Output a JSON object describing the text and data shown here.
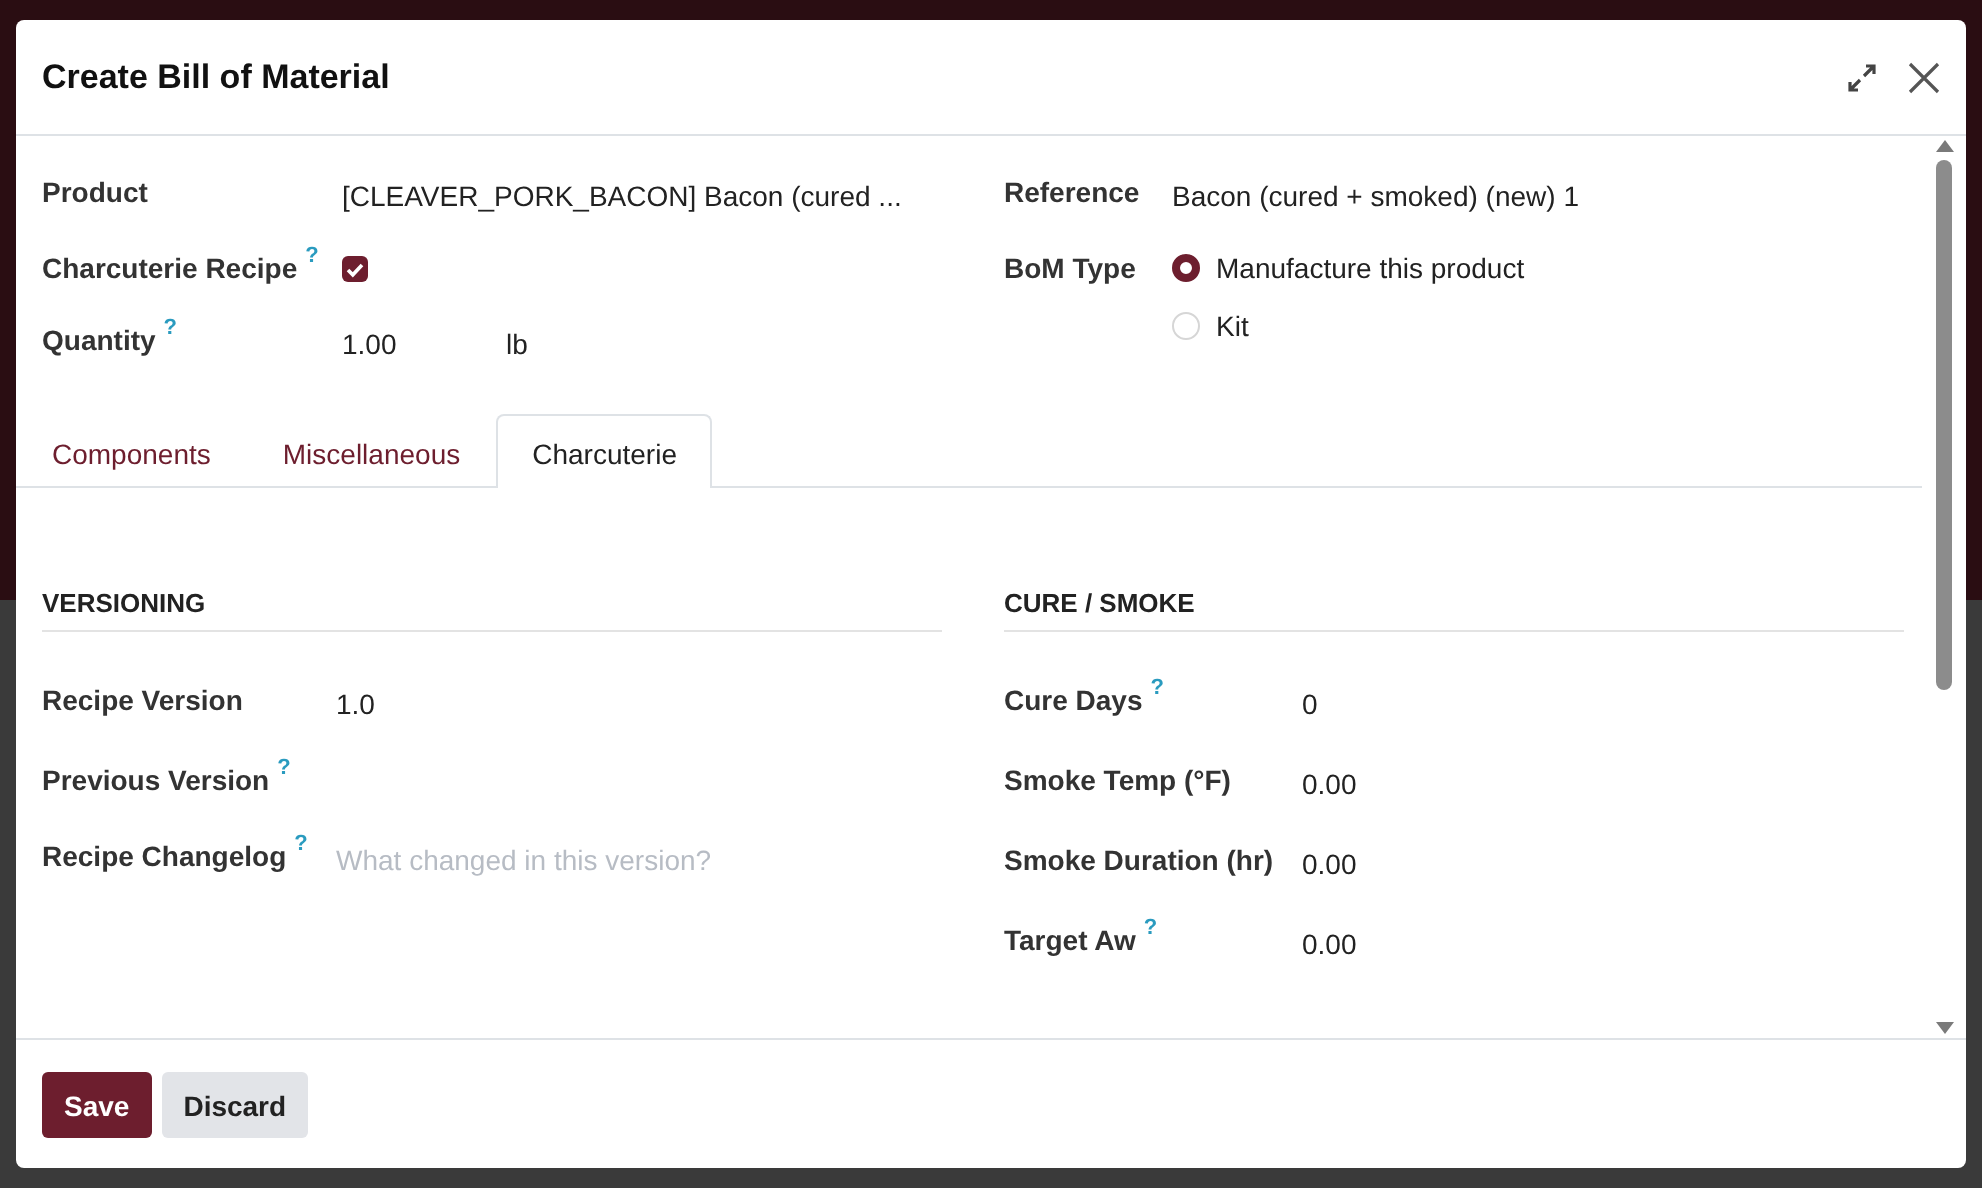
{
  "dialog": {
    "title": "Create Bill of Material"
  },
  "header_fields": {
    "left": [
      {
        "kind": "text",
        "label": "Product",
        "value": "[CLEAVER_PORK_BACON] Bacon (cured ..."
      },
      {
        "kind": "checkbox",
        "label": "Charcuterie Recipe",
        "help": "?",
        "checked": true
      },
      {
        "kind": "quantity",
        "label": "Quantity",
        "help": "?",
        "value": "1.00",
        "unit": "lb"
      }
    ],
    "right": [
      {
        "kind": "text",
        "label": "Reference",
        "value": "Bacon (cured + smoked) (new) 1"
      },
      {
        "kind": "radio",
        "label": "BoM Type",
        "options": [
          {
            "label": "Manufacture this product",
            "selected": true
          },
          {
            "label": "Kit",
            "selected": false
          }
        ]
      }
    ]
  },
  "tabs": [
    {
      "label": "Components",
      "selected": false
    },
    {
      "label": "Miscellaneous",
      "selected": false
    },
    {
      "label": "Charcuterie",
      "selected": true
    }
  ],
  "sections": [
    {
      "title": "VERSIONING",
      "fields": [
        {
          "kind": "text",
          "label": "Recipe Version",
          "value": "1.0"
        },
        {
          "kind": "text",
          "label": "Previous Version",
          "help": "?"
        },
        {
          "kind": "textarea",
          "label": "Recipe Changelog",
          "help": "?",
          "placeholder": "What changed in this version?"
        }
      ]
    },
    {
      "title": "CURE / SMOKE",
      "fields": [
        {
          "kind": "text",
          "label": "Cure Days",
          "help": "?",
          "value": "0"
        },
        {
          "kind": "text",
          "label": "Smoke Temp (°F)",
          "value": "0.00"
        },
        {
          "kind": "text",
          "label": "Smoke Duration (hr)",
          "value": "0.00"
        },
        {
          "kind": "text",
          "label": "Target Aw",
          "help": "?",
          "value": "0.00"
        }
      ]
    }
  ],
  "buttons": [
    {
      "label": "Save",
      "kind": "primary"
    },
    {
      "label": "Discard",
      "kind": "secondary"
    }
  ]
}
